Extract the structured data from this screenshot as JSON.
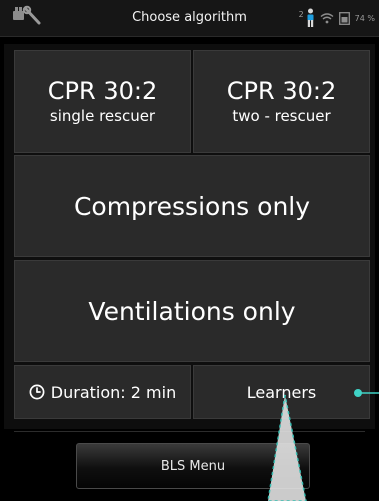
{
  "status_bar": {
    "title": "Choose algorithm",
    "tool_icon": "wrench-screwdriver-icon",
    "learner_count": "2",
    "learner_icon": "person-icon",
    "wifi_icon": "wifi-icon",
    "battery_icon": "battery-icon",
    "battery_percent": "74 %"
  },
  "tiles": {
    "cpr_single": {
      "title": "CPR 30:2",
      "subtitle": "single rescuer"
    },
    "cpr_two": {
      "title": "CPR 30:2",
      "subtitle": "two - rescuer"
    },
    "compressions": {
      "label": "Compressions only"
    },
    "ventilations": {
      "label": "Ventilations only"
    },
    "duration": {
      "label": "Duration: 2 min",
      "icon": "clock-icon"
    },
    "learners": {
      "label": "Learners"
    }
  },
  "bottom": {
    "menu_label": "BLS Menu"
  },
  "colors": {
    "tile_bg": "#2a2a2a",
    "callout": "#3fd3c6",
    "background": "#000000"
  }
}
